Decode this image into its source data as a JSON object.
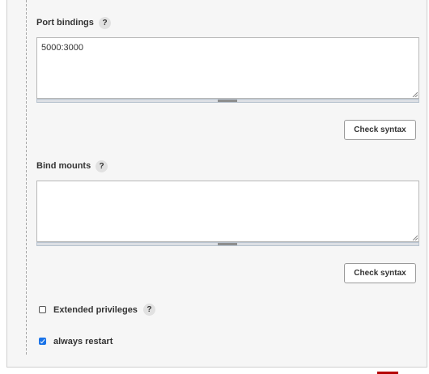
{
  "port_bindings": {
    "label": "Port bindings",
    "help": "?",
    "value": "5000:3000",
    "check_syntax_label": "Check syntax"
  },
  "bind_mounts": {
    "label": "Bind mounts",
    "help": "?",
    "value": "",
    "check_syntax_label": "Check syntax"
  },
  "extended_privileges": {
    "label": "Extended privileges",
    "help": "?",
    "checked": false
  },
  "always_restart": {
    "label": "always restart",
    "checked": true
  },
  "colors": {
    "panel_background": "#f6f6f6",
    "checkbox_accent": "#1a73e8",
    "footer_accent": "#b50000"
  }
}
